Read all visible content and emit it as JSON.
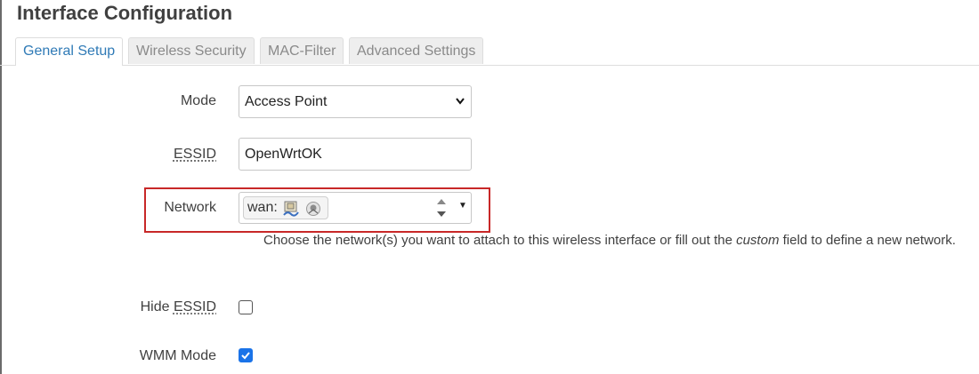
{
  "page": {
    "title": "Interface Configuration"
  },
  "tabs": [
    {
      "label": "General Setup",
      "active": true
    },
    {
      "label": "Wireless Security",
      "active": false
    },
    {
      "label": "MAC-Filter",
      "active": false
    },
    {
      "label": "Advanced Settings",
      "active": false
    }
  ],
  "form": {
    "mode": {
      "label": "Mode",
      "value": "Access Point"
    },
    "essid": {
      "label": "ESSID",
      "value": "OpenWrtOK"
    },
    "network": {
      "label": "Network",
      "chip_text": "wan:",
      "chip_icons": [
        "ethernet-port-icon",
        "wifi-device-icon"
      ],
      "help_prefix": "Choose the network(s) you want to attach to this wireless interface or fill out the ",
      "help_emphasis": "custom",
      "help_suffix": " field to define a new network."
    },
    "hide_essid": {
      "label_prefix": "Hide ",
      "label_abbr": "ESSID",
      "checked": false
    },
    "wmm_mode": {
      "label": "WMM Mode",
      "checked": true
    }
  },
  "colors": {
    "accent": "#2f7ab6",
    "highlight": "#c82828",
    "checkbox": "#1a73e8"
  }
}
